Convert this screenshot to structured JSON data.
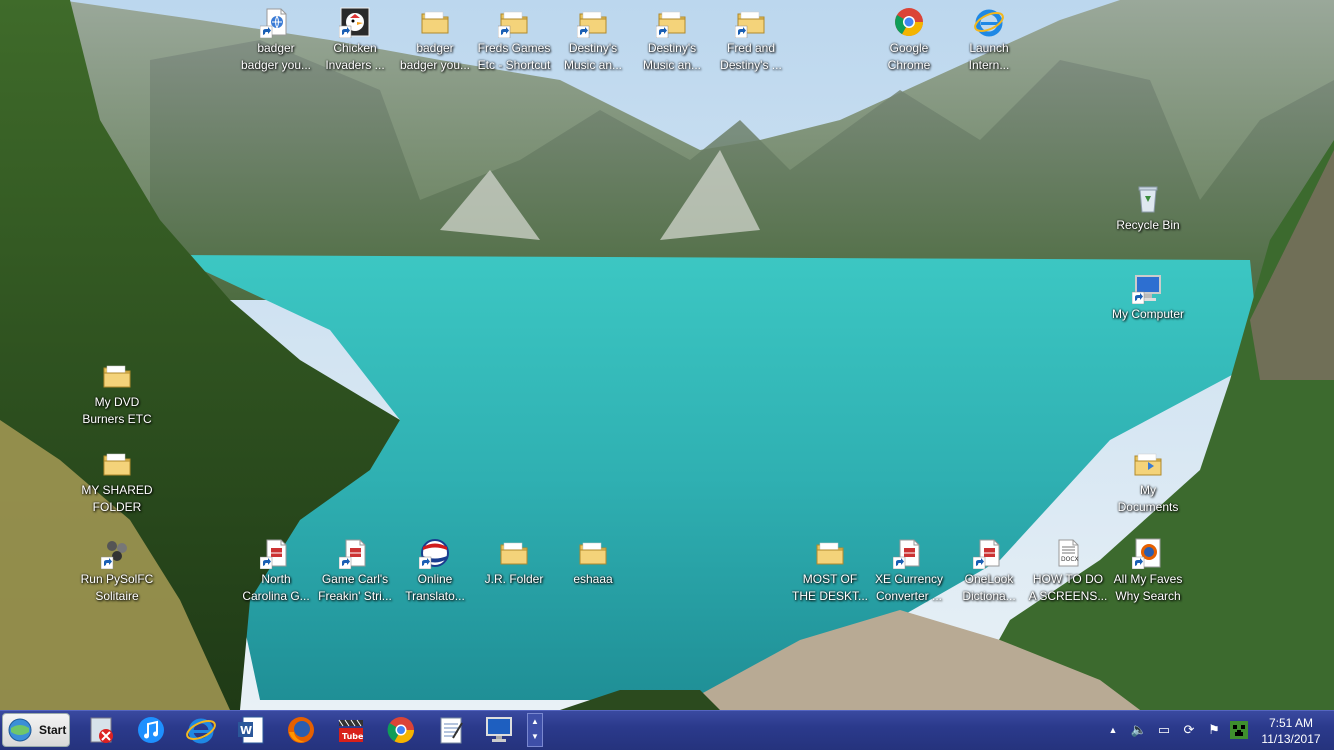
{
  "desktop": {
    "top_icons": [
      {
        "label": "badger\nbadger you...",
        "icon": "internet-shortcut-icon"
      },
      {
        "label": "Chicken\nInvaders ...",
        "icon": "chicken-invaders-icon"
      },
      {
        "label": "badger\nbadger you...",
        "icon": "folder-icon"
      },
      {
        "label": "Freds Games\nEtc - Shortcut",
        "icon": "folder-shortcut-icon"
      },
      {
        "label": "Destiny's\nMusic an...",
        "icon": "folder-shortcut-icon"
      },
      {
        "label": "Destiny's\nMusic an...",
        "icon": "folder-shortcut-icon"
      },
      {
        "label": "Fred and\nDestiny's ...",
        "icon": "folder-shortcut-icon"
      },
      {
        "label": "Google\nChrome",
        "icon": "chrome-icon"
      },
      {
        "label": "Launch\nIntern...",
        "icon": "internet-explorer-icon"
      }
    ],
    "right_icons": [
      {
        "label": "Recycle Bin",
        "icon": "recycle-bin-icon"
      },
      {
        "label": "My Computer",
        "icon": "my-computer-icon"
      },
      {
        "label": "My\nDocuments",
        "icon": "my-documents-icon"
      }
    ],
    "left_icons": [
      {
        "label": "My DVD\nBurners ETC",
        "icon": "folder-icon"
      },
      {
        "label": "MY SHARED\nFOLDER",
        "icon": "folder-icon"
      },
      {
        "label": "Run PySolFC\nSolitaire",
        "icon": "solitaire-icon"
      }
    ],
    "bottom_icons": [
      {
        "label": "North\nCarolina G...",
        "icon": "document-shortcut-icon"
      },
      {
        "label": "Game Carl's\nFreakin' Stri...",
        "icon": "document-shortcut-icon"
      },
      {
        "label": "Online\nTranslato...",
        "icon": "pepsi-shortcut-icon"
      },
      {
        "label": "J.R. Folder",
        "icon": "folder-icon"
      },
      {
        "label": "eshaaa",
        "icon": "folder-icon"
      },
      {
        "label": "MOST OF\nTHE DESKT...",
        "icon": "folder-icon"
      },
      {
        "label": "XE Currency\nConverter ...",
        "icon": "document-shortcut-icon"
      },
      {
        "label": "OneLook\nDictiona...",
        "icon": "document-shortcut-icon"
      },
      {
        "label": "HOW TO DO\nA SCREENS...",
        "icon": "docx-file-icon"
      },
      {
        "label": "All My Faves\nWhy Search",
        "icon": "firefox-shortcut-icon"
      }
    ]
  },
  "taskbar": {
    "start_label": "Start",
    "pinned": [
      {
        "name": "recycle-app-icon"
      },
      {
        "name": "itunes-icon"
      },
      {
        "name": "internet-explorer-icon"
      },
      {
        "name": "word-icon"
      },
      {
        "name": "firefox-icon"
      },
      {
        "name": "youtube-movie-icon"
      },
      {
        "name": "chrome-icon"
      },
      {
        "name": "notepad-icon"
      },
      {
        "name": "monitor-icon"
      }
    ],
    "tray": [
      "show-hidden-icons-icon",
      "volume-icon",
      "network-icon",
      "sync-icon",
      "flag-icon",
      "minecraft-icon"
    ],
    "clock_time": "7:51 AM",
    "clock_date": "11/13/2017"
  }
}
